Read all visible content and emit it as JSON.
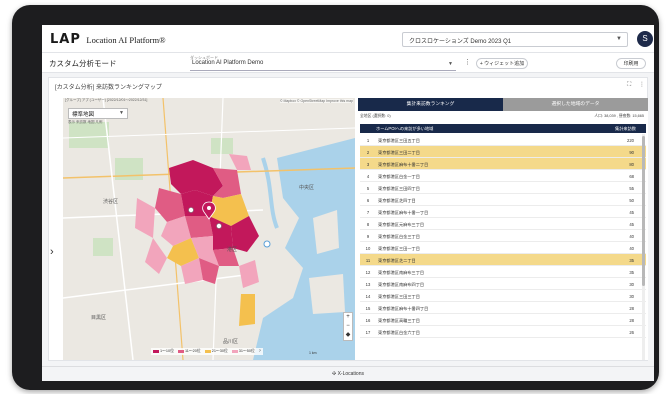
{
  "app": {
    "logo_mark": "LAP",
    "logo_sub": "Location AI Platform®",
    "org_name": "クロスロケーションズ Demo 2023 Q1",
    "user_initial": "S"
  },
  "subbar": {
    "mode_title": "カスタム分析モード",
    "dashboard_label": "ダッシュボード",
    "dashboard_name": "Location AI Platform Demo",
    "add_widget": "+ ウィジェット追加",
    "print": "印刷用"
  },
  "widget": {
    "title": "[カスタム分析] 来訪数ランキングマップ",
    "map_meta": "[グループ] アプ (ユーザー) [2022/12/01〜2022/12/31]",
    "map_attribution": "© Mapbox © OpenStreetMap Improve this map",
    "layer_value": "標準地図",
    "layer_sub": "表示 来訪数 地図 凡例",
    "map_labels": [
      "中央区",
      "港区",
      "品川区",
      "目黒区",
      "渋谷区"
    ],
    "legend": [
      {
        "label": "1〜10位",
        "color": "#c2185b"
      },
      {
        "label": "11〜20位",
        "color": "#e05c84"
      },
      {
        "label": "21〜30位",
        "color": "#f4c04e"
      },
      {
        "label": "31〜50位",
        "color": "#f2a5bc"
      }
    ],
    "scale_label": "1 km"
  },
  "ranking": {
    "tab_active": "集計来訪数ランキング",
    "tab_inactive": "選択した地域のデータ",
    "info_left": "全地区 (選択数: 0)",
    "info_right": "人口: 38,039 , 昼夜数: 15,665",
    "col_area": "ホームPOIへの来訪が多い地域",
    "col_count": "集計来訪数",
    "rows": [
      {
        "rank": "1",
        "name": "東京都港区三田五丁目",
        "value": "220",
        "highlight": false
      },
      {
        "rank": "2",
        "name": "東京都港区三田二丁目",
        "value": "90",
        "highlight": true
      },
      {
        "rank": "3",
        "name": "東京都港区麻布十番二丁目",
        "value": "80",
        "highlight": true
      },
      {
        "rank": "4",
        "name": "東京都港区白金一丁目",
        "value": "68",
        "highlight": false
      },
      {
        "rank": "5",
        "name": "東京都港区三田四丁目",
        "value": "55",
        "highlight": false
      },
      {
        "rank": "6",
        "name": "東京都港区芝四丁目",
        "value": "50",
        "highlight": false
      },
      {
        "rank": "7",
        "name": "東京都港区麻布十番一丁目",
        "value": "45",
        "highlight": false
      },
      {
        "rank": "8",
        "name": "東京都港区元麻布三丁目",
        "value": "45",
        "highlight": false
      },
      {
        "rank": "9",
        "name": "東京都港区白金三丁目",
        "value": "40",
        "highlight": false
      },
      {
        "rank": "10",
        "name": "東京都港区三田一丁目",
        "value": "40",
        "highlight": false
      },
      {
        "rank": "11",
        "name": "東京都港区芝二丁目",
        "value": "35",
        "highlight": true
      },
      {
        "rank": "12",
        "name": "東京都港区南麻布三丁目",
        "value": "35",
        "highlight": false
      },
      {
        "rank": "13",
        "name": "東京都港区南麻布四丁目",
        "value": "30",
        "highlight": false
      },
      {
        "rank": "14",
        "name": "東京都港区三田三丁目",
        "value": "30",
        "highlight": false
      },
      {
        "rank": "15",
        "name": "東京都港区麻布十番四丁目",
        "value": "28",
        "highlight": false
      },
      {
        "rank": "16",
        "name": "東京都港区高輪三丁目",
        "value": "28",
        "highlight": false
      },
      {
        "rank": "17",
        "name": "東京都港区白金六丁目",
        "value": "26",
        "highlight": false
      }
    ]
  },
  "footer": {
    "brand": "X-Locations"
  }
}
